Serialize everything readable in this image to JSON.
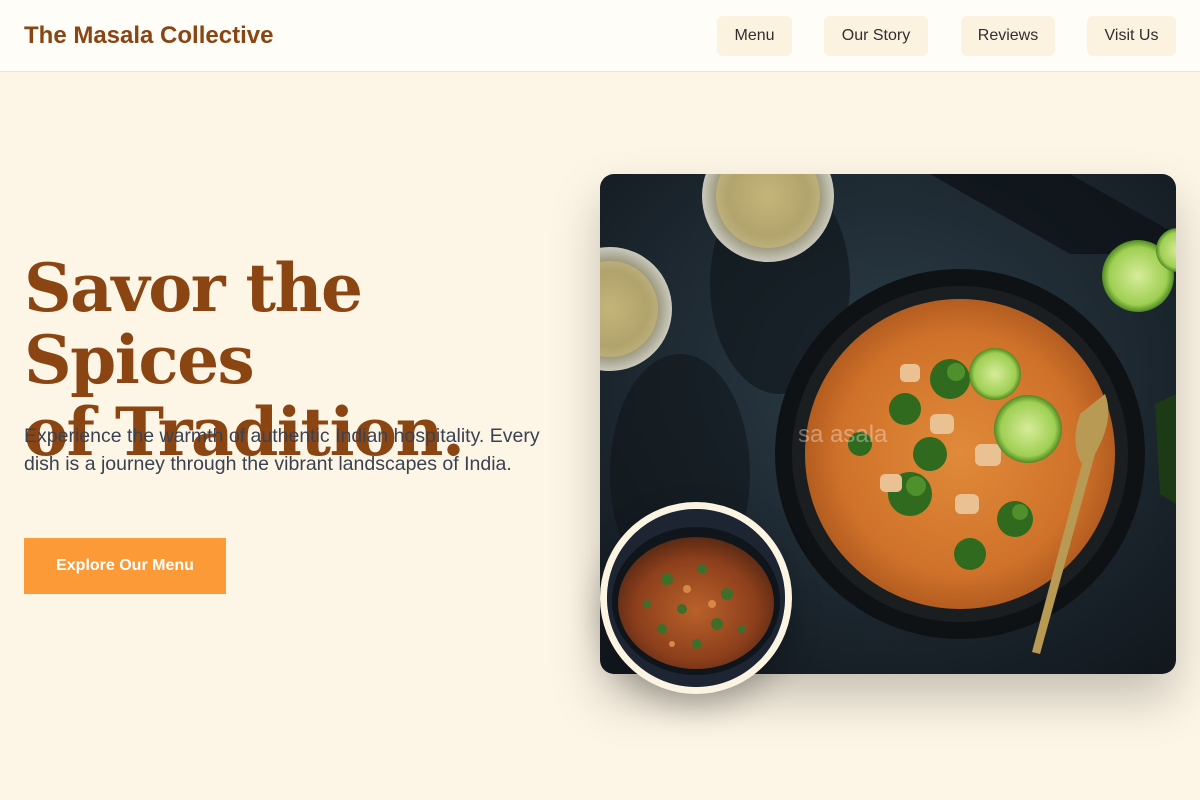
{
  "header": {
    "brand": "The Masala Collective",
    "nav": [
      {
        "label": "Menu"
      },
      {
        "label": "Our Story"
      },
      {
        "label": "Reviews"
      },
      {
        "label": "Visit Us"
      }
    ]
  },
  "hero": {
    "headline_line1": "Savor the Spices",
    "headline_line2": "of Tradition.",
    "subtext": "Experience the warmth of authentic Indian hospitality. Every dish is a journey through the vibrant landscapes of India.",
    "cta_label": "Explore Our Menu",
    "image_watermark": "sa    asala"
  },
  "colors": {
    "background": "#fdf6e6",
    "brand": "#8b4513",
    "accent": "#fb9a37"
  }
}
